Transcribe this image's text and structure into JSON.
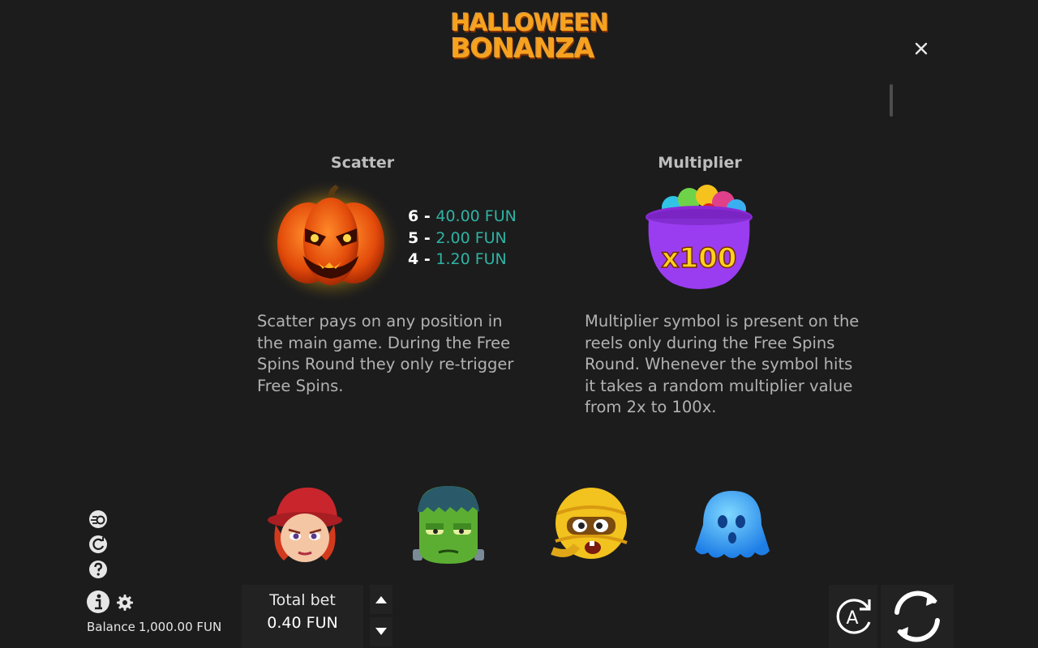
{
  "game": {
    "logo_line1": "HALLOWEEN",
    "logo_line2": "BONANZA"
  },
  "paytable": {
    "scatter": {
      "title": "Scatter",
      "pays": [
        {
          "count": "6",
          "amount": "40.00 FUN"
        },
        {
          "count": "5",
          "amount": "2.00 FUN"
        },
        {
          "count": "4",
          "amount": "1.20 FUN"
        }
      ],
      "description": "Scatter pays on any position in the main game. During the Free Spins Round they only re-trigger Free Spins."
    },
    "multiplier": {
      "title": "Multiplier",
      "badge": "x100",
      "description": "Multiplier symbol is present on the reels only during the Free Spins Round. Whenever the symbol hits it takes a random multiplier value from 2x to 100x."
    },
    "symbols": [
      "witch-icon",
      "frankenstein-icon",
      "mummy-icon",
      "ghost-icon"
    ]
  },
  "footer": {
    "balance_label": "Balance",
    "balance_value": "1,000.00 FUN",
    "total_bet_label": "Total bet",
    "total_bet_value": "0.40 FUN",
    "autoplay_label": "A"
  },
  "colors": {
    "background": "#1c1c1c",
    "pay_amount": "#2fb3a4",
    "logo": "#f6a21e"
  }
}
